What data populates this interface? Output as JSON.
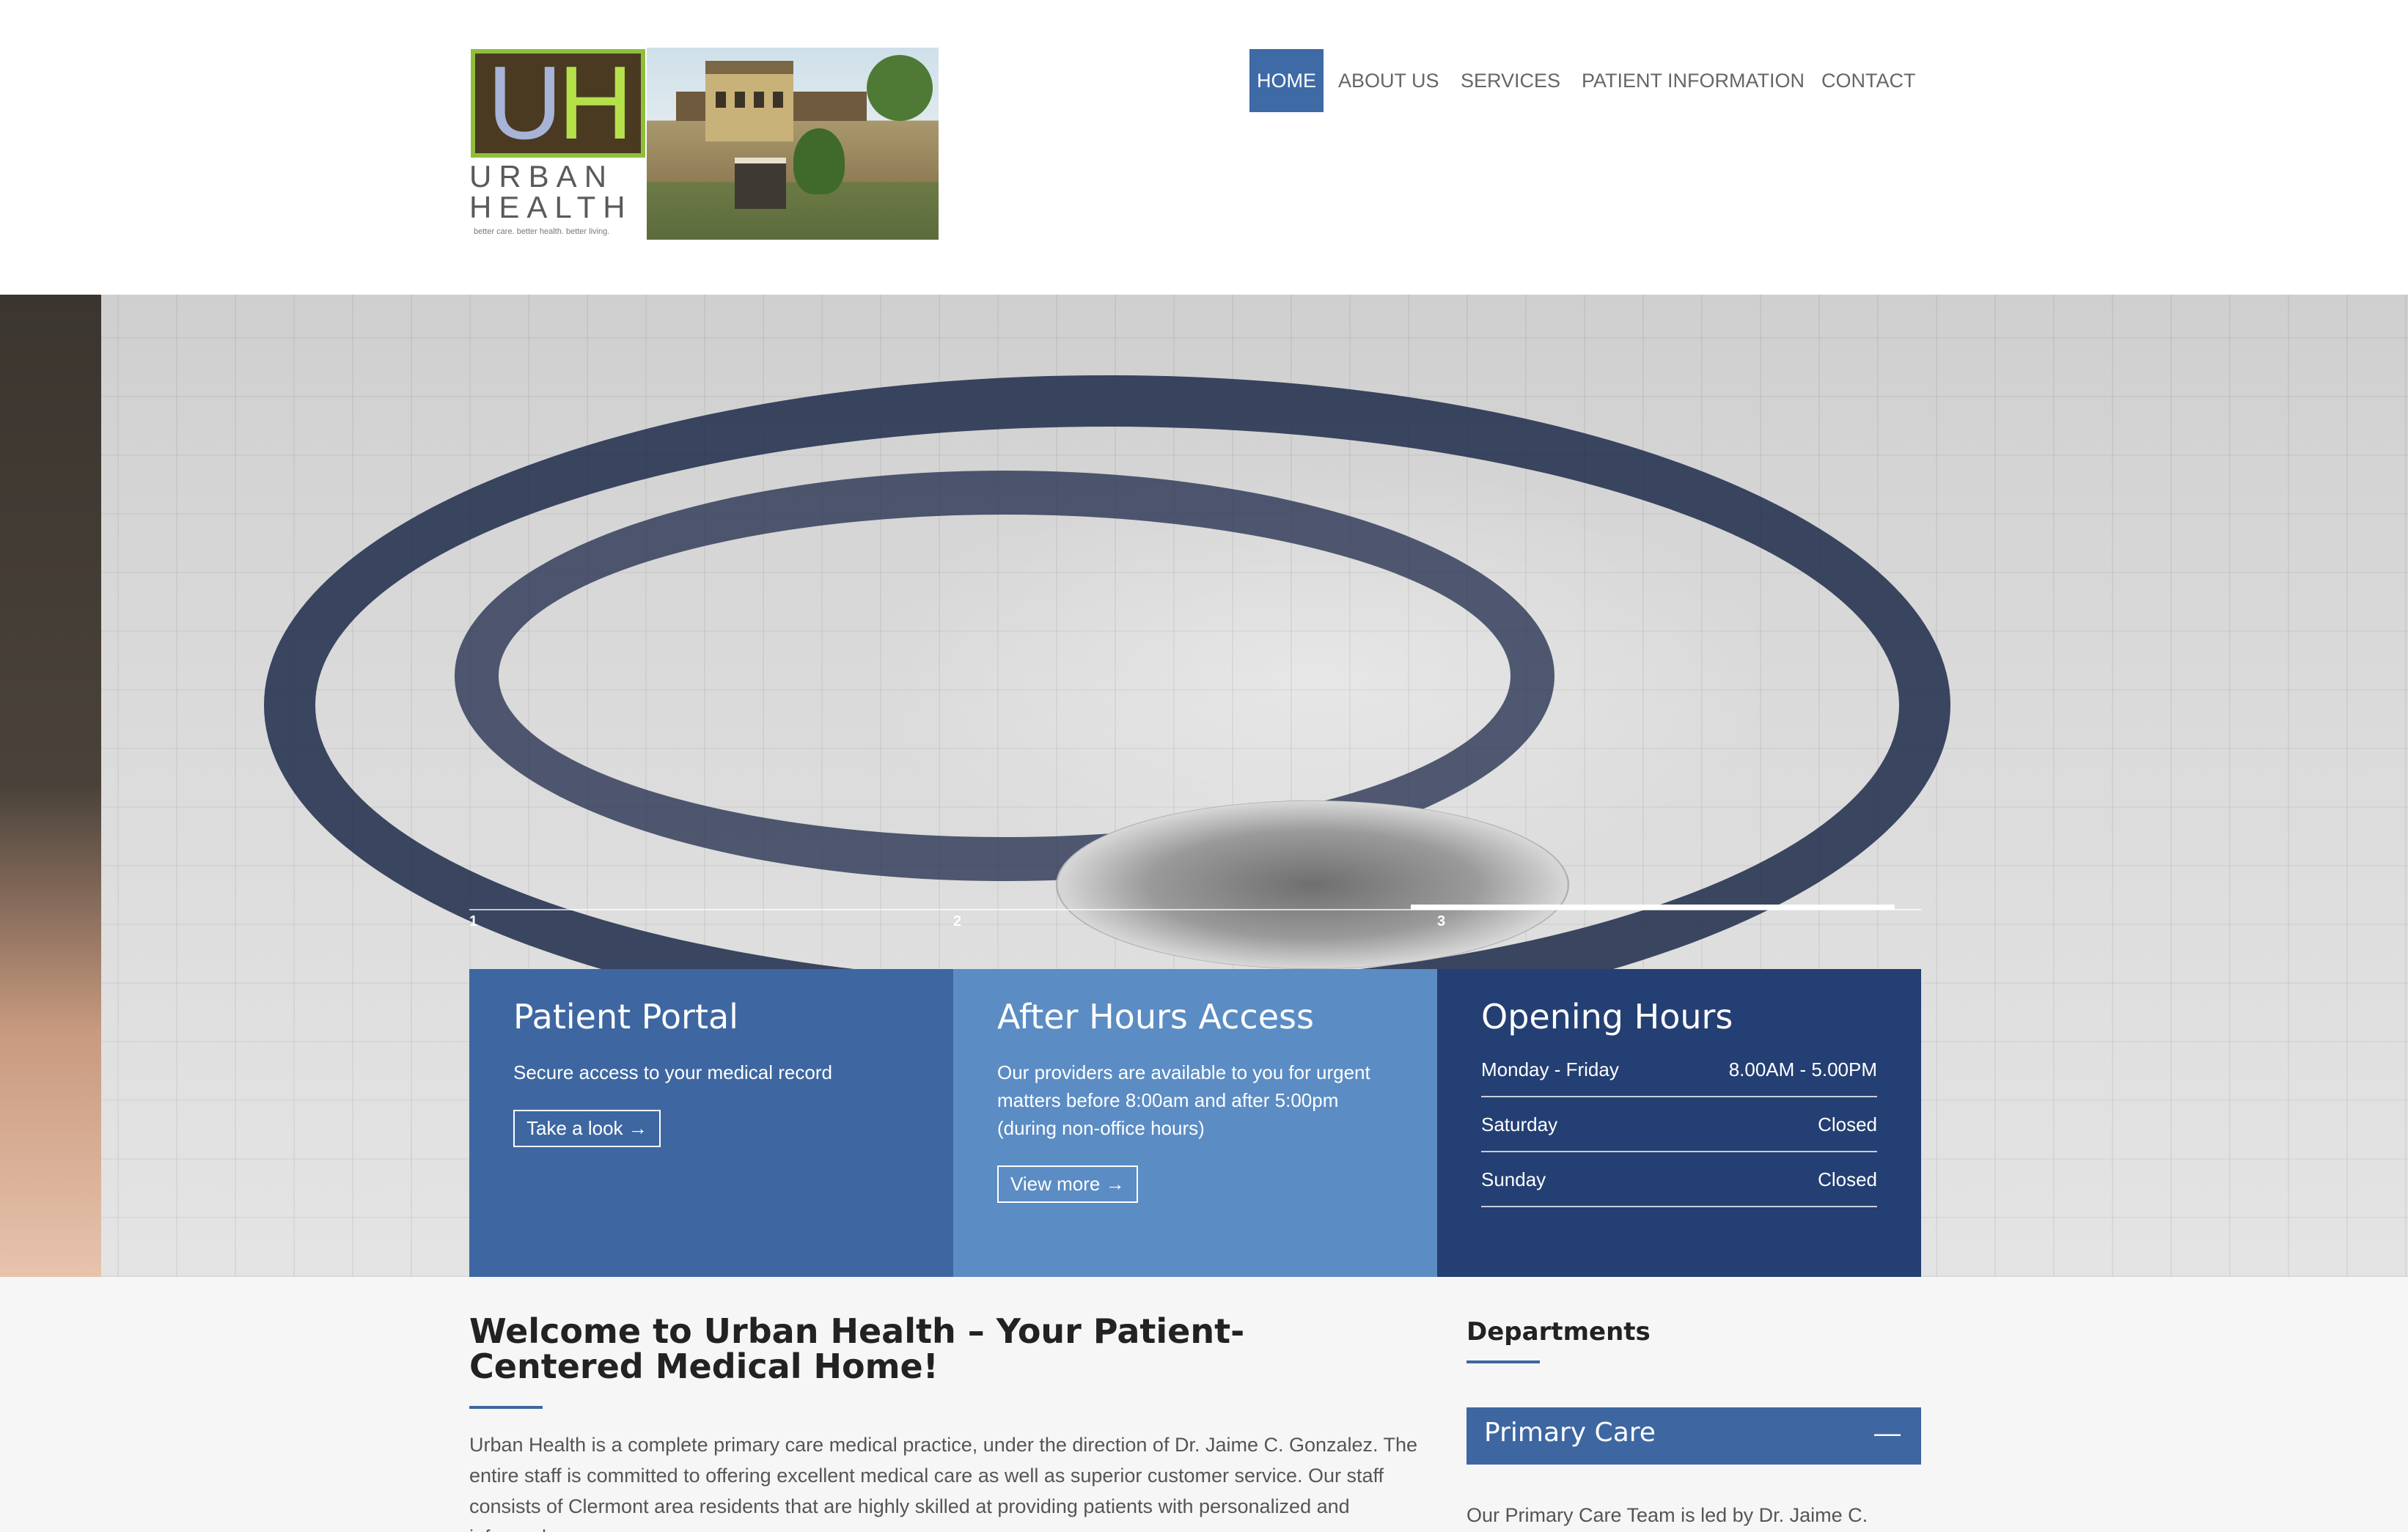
{
  "logo": {
    "mark": "UH",
    "name_line1": "URBAN",
    "name_line2": "HEALTH",
    "tagline": "better care. better health. better living."
  },
  "nav": {
    "items": [
      {
        "label": "HOME",
        "active": true
      },
      {
        "label": "ABOUT US",
        "active": false
      },
      {
        "label": "SERVICES",
        "active": false
      },
      {
        "label": "PATIENT INFORMATION",
        "active": false
      },
      {
        "label": "CONTACT",
        "active": false
      }
    ]
  },
  "slider": {
    "slides": [
      "1",
      "2",
      "3"
    ],
    "active_slide": 3
  },
  "boxes": {
    "portal": {
      "title": "Patient Portal",
      "text": "Secure access to your medical record",
      "button": "Take a look →"
    },
    "after_hours": {
      "title": "After Hours Access",
      "text": "Our providers are available to you for urgent matters before 8:00am and after 5:00pm (during non-office hours)",
      "button": "View more →"
    },
    "hours": {
      "title": "Opening Hours",
      "rows": [
        {
          "day": "Monday - Friday",
          "time": "8.00AM - 5.00PM"
        },
        {
          "day": "Saturday",
          "time": "Closed"
        },
        {
          "day": "Sunday",
          "time": "Closed"
        }
      ]
    }
  },
  "welcome": {
    "title": "Welcome to Urban Health – Your Patient-Centered Medical Home!",
    "body": "Urban Health is a complete primary care medical practice, under the direction of Dr. Jaime C. Gonzalez. The entire staff is committed to offering excellent medical care as well as superior customer service. Our staff consists of Clermont area residents that are highly skilled at providing patients with personalized and informed care."
  },
  "departments": {
    "title": "Departments",
    "open_item": "Primary Care",
    "toggle": "—",
    "body": "Our Primary Care Team is led by Dr. Jaime C."
  },
  "colors": {
    "primary_blue": "#3e67a2",
    "light_blue": "#5b8cc4",
    "dark_blue": "#243f73",
    "logo_green": "#8fbf3a",
    "logo_brown": "#4a3a22"
  }
}
